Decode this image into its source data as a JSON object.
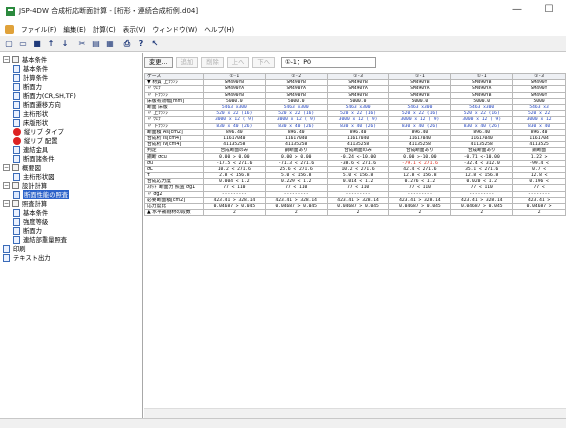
{
  "window": {
    "title": "JSP-4DW 合成桁応断面計算 - [桁形・連続合成桁例.d04]",
    "min": "—",
    "max": "☐"
  },
  "menu": [
    "ファイル(F)",
    "編集(E)",
    "計算(C)",
    "表示(V)",
    "ウィンドウ(W)",
    "ヘルプ(H)"
  ],
  "toolbar_icons": [
    "new-icon",
    "open-icon",
    "save-icon",
    "up-icon",
    "down-icon",
    "cut-icon",
    "copy-icon",
    "paste-icon",
    "print-icon",
    "help-icon",
    "pointer-help-icon"
  ],
  "tree": [
    {
      "label": "基本条件",
      "level": 0,
      "type": "group",
      "exp": "−"
    },
    {
      "label": "基本条件",
      "level": 1,
      "type": "doc"
    },
    {
      "label": "計算条件",
      "level": 1,
      "type": "doc"
    },
    {
      "label": "断面力",
      "level": 1,
      "type": "doc"
    },
    {
      "label": "断面力(CR,SH,TF)",
      "level": 1,
      "type": "doc"
    },
    {
      "label": "断面遷移方向",
      "level": 1,
      "type": "doc"
    },
    {
      "label": "主桁形状",
      "level": 1,
      "type": "doc"
    },
    {
      "label": "床版形状",
      "level": 1,
      "type": "doc"
    },
    {
      "label": "縦リブ タイプ",
      "level": 1,
      "type": "red"
    },
    {
      "label": "縦リブ 配置",
      "level": 1,
      "type": "red"
    },
    {
      "label": "連結金具",
      "level": 1,
      "type": "doc"
    },
    {
      "label": "断面諸条件",
      "level": 1,
      "type": "doc"
    },
    {
      "label": "概要図",
      "level": 0,
      "type": "group",
      "exp": "−"
    },
    {
      "label": "主桁形状図",
      "level": 1,
      "type": "doc"
    },
    {
      "label": "設計計算",
      "level": 0,
      "type": "group",
      "exp": "−"
    },
    {
      "label": "断面性能の照査",
      "level": 1,
      "type": "chk",
      "selected": true
    },
    {
      "label": "照査計算",
      "level": 0,
      "type": "group",
      "exp": "−"
    },
    {
      "label": "基本条件",
      "level": 1,
      "type": "doc"
    },
    {
      "label": "強度等級",
      "level": 1,
      "type": "doc"
    },
    {
      "label": "断面力",
      "level": 1,
      "type": "doc"
    },
    {
      "label": "連結部重量照査",
      "level": 1,
      "type": "doc"
    },
    {
      "label": "印刷",
      "level": 0,
      "type": "doc"
    },
    {
      "label": "テキスト出力",
      "level": 0,
      "type": "doc"
    }
  ],
  "actions": {
    "change": "変更...",
    "insert": "追加",
    "delete": "削除",
    "up": "上へ",
    "down": "下へ",
    "combo": "①-1：P0"
  },
  "columns": [
    "①-1",
    "①-2",
    "①-3",
    "①-1",
    "①-1",
    "①-3"
  ],
  "rows": [
    {
      "label": "ケース",
      "vals": [
        "①-1",
        "①-2",
        "①-3",
        "①-1",
        "①-1",
        "①-3"
      ],
      "blue": false
    },
    {
      "label": "▼ 材質  上ﾌﾗﾝｼﾞ",
      "vals": [
        "SM490YB",
        "SM490YB",
        "SM490YB",
        "SM490YB",
        "SM490YB",
        "SM490Y"
      ],
      "blue": false
    },
    {
      "label": "  〃  ｳｪﾌﾞ",
      "vals": [
        "SM490YA",
        "SM490YA",
        "SM490YA",
        "SM490YA",
        "SM490YA",
        "SM490Y"
      ],
      "blue": false
    },
    {
      "label": "  〃  下ﾌﾗﾝｼﾞ",
      "vals": [
        "SM490YB",
        "SM490YB",
        "SM490YB",
        "SM490YB",
        "SM490YB",
        "SM490Y"
      ],
      "blue": false
    },
    {
      "label": "床版有効幅[mm]",
      "vals": [
        "5000.0",
        "5000.0",
        "5000.0",
        "5000.0",
        "5000.0",
        "5000"
      ],
      "blue": false
    },
    {
      "label": "断面  床版",
      "vals": [
        "5463 x300",
        "5463 x300",
        "5463 x300",
        "5463 x300",
        "5463 x300",
        "5463 x3"
      ],
      "blue": true
    },
    {
      "label": "  〃  上ﾌﾗﾝｼﾞ",
      "vals": [
        "520 x 22 (16)",
        "520 x 22 (16)",
        "520 x 22 (16)",
        "520 x 22 (16)",
        "520 x 22 (16)",
        "520 x 22"
      ],
      "blue": true
    },
    {
      "label": "  〃  ｳｪﾌﾞ",
      "vals": [
        "3000 x 12 ( 9)",
        "3000 x 12 ( 9)",
        "3000 x 12 ( 9)",
        "3000 x 12 ( 9)",
        "3000 x 12 ( 9)",
        "3000 x 12"
      ],
      "blue": true
    },
    {
      "label": "  〃  下ﾌﾗﾝｼﾞ",
      "vals": [
        "830 x 40 (26)",
        "830 x 40 (26)",
        "830 x 40 (26)",
        "830 x 40 (26)",
        "830 x 40 (26)",
        "830 x 40"
      ],
      "blue": true
    },
    {
      "label": "断面積 As[cm2]",
      "vals": [
        "896.40",
        "896.40",
        "896.40",
        "896.40",
        "896.40",
        "896.40"
      ],
      "blue": false
    },
    {
      "label": "合成桁 Is[cm4]",
      "vals": [
        "11617040",
        "11617040",
        "11617040",
        "11617040",
        "11617040",
        "1161704"
      ],
      "blue": false
    },
    {
      "label": "合成桁 Iv[cm4]",
      "vals": [
        "41135258",
        "41135258",
        "41135258",
        "41135258",
        "41135258",
        "4113525"
      ],
      "blue": false
    },
    {
      "label": "判定",
      "vals": [
        "合成断面のみ",
        "鋼断面あり",
        "合成断面のみ",
        "合成断面あり",
        "合成断面あり",
        "鋼断面"
      ],
      "blue": false
    },
    {
      "label": "鋼断 σcu",
      "vals": [
        "0.00 > 0.00",
        "0.00 > 0.00",
        "-0.24 <-10.00",
        "0.00 >-10.00",
        "-0.71 <-10.00",
        "1.22 >"
      ],
      "blue": false
    },
    {
      "label": "σu",
      "vals": [
        "-17.5 < 271.6",
        "-71.3 < 271.6",
        "-38.6 < 271.6",
        "-79.1 < 271.6",
        "-32.4 < 312.0",
        "-99.4 <"
      ],
      "blue": false,
      "red": [
        3
      ]
    },
    {
      "label": "σL",
      "vals": [
        "10.2 < 271.6",
        "25.6 < 271.6",
        "10.2 < 271.6",
        "42.4 < 271.6",
        "35.1 < 271.6",
        "0.7 <"
      ],
      "blue": false
    },
    {
      "label": "τ",
      "vals": [
        "2.8 < 156.8",
        "5.0 < 156.8",
        "5.0 < 156.8",
        "12.8 < 156.8",
        "12.8 < 156.8",
        "12.8 <"
      ],
      "blue": false
    },
    {
      "label": "合成応力度",
      "vals": [
        "0.004 < 1.2",
        "0.229 < 1.2",
        "0.014 < 1.2",
        "0.276 < 1.2",
        "0.020 < 1.2",
        "0.196 <"
      ],
      "blue": false
    },
    {
      "label": "ｽﾀｯﾄﾞ断面力 照査 σg1",
      "vals": [
        "77 < 110",
        "77 < 110",
        "77 < 110",
        "77 < 110",
        "77 < 110",
        "77 <"
      ],
      "blue": false
    },
    {
      "label": "  〃  σg2",
      "vals": [
        "---------",
        "---------",
        "---------",
        "---------",
        "---------",
        "--------"
      ],
      "blue": false
    },
    {
      "label": "必要断面積[cm2]",
      "vals": [
        "423.41 > 328.14",
        "423.41 > 328.14",
        "423.41 > 328.14",
        "423.41 > 328.14",
        "423.41 > 328.14",
        "423.41 >"
      ],
      "blue": false
    },
    {
      "label": "応力度比",
      "vals": [
        "0.04687 > 0.045",
        "0.04687 > 0.045",
        "0.04687 > 0.045",
        "0.04687 > 0.045",
        "0.04687 > 0.045",
        "0.04687 >"
      ],
      "blue": false
    },
    {
      "label": "▲ 水平補剛材の段数",
      "vals": [
        "2",
        "2",
        "2",
        "2",
        "2",
        "2"
      ],
      "blue": false
    }
  ]
}
